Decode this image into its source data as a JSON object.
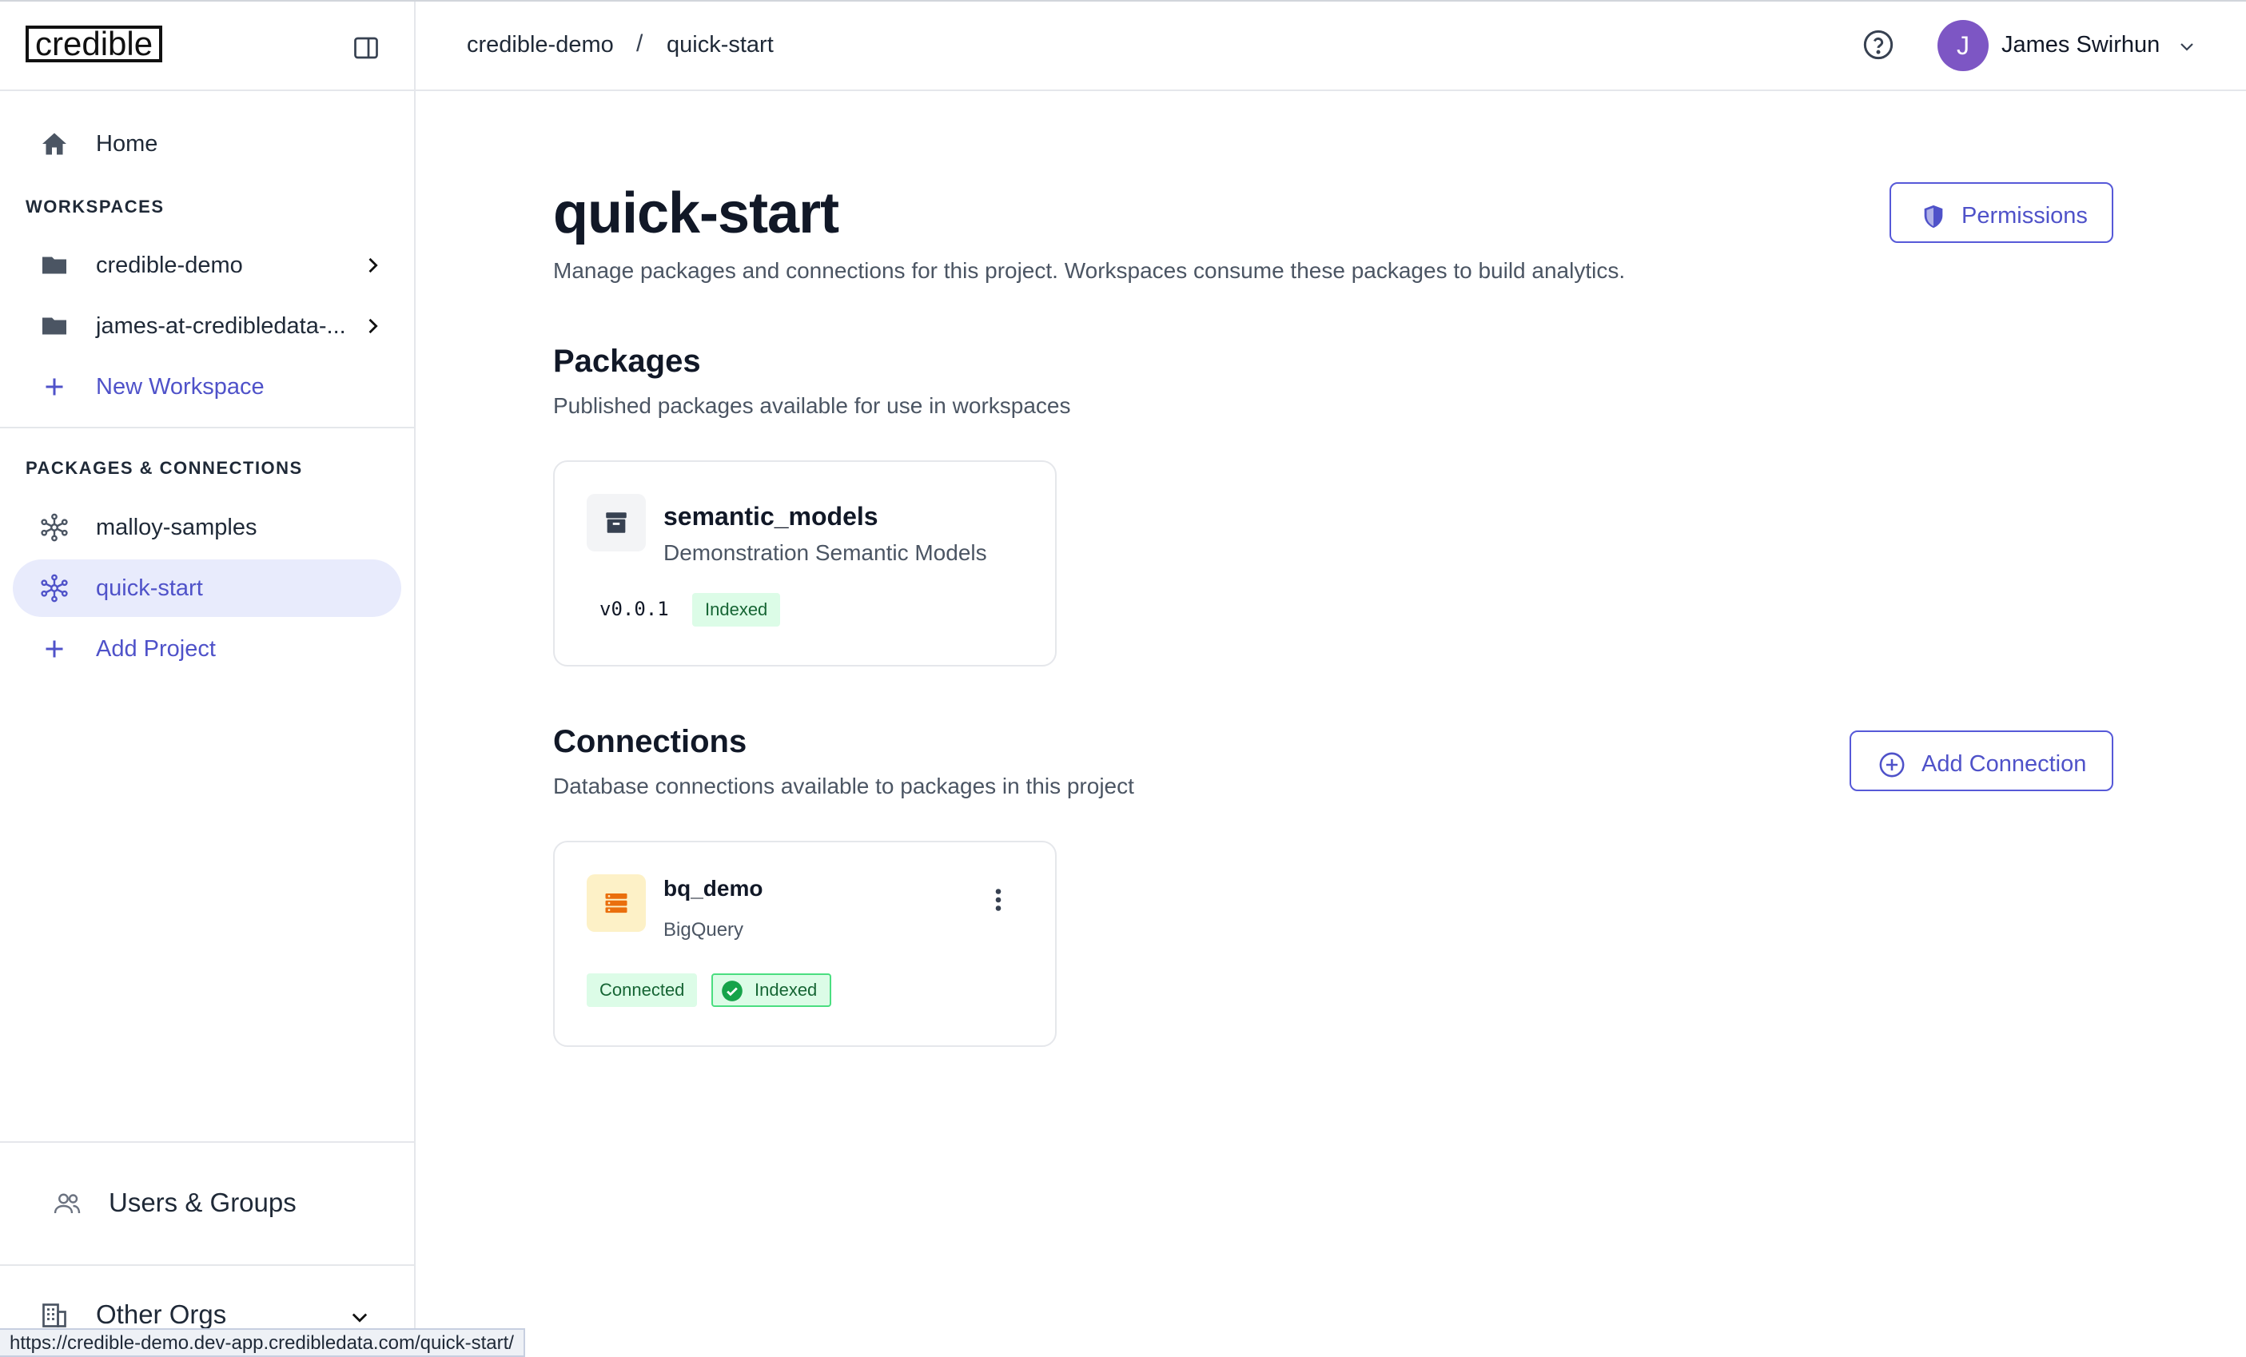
{
  "brand": {
    "logo_text": "credible"
  },
  "breadcrumb": {
    "org": "credible-demo",
    "separator": "/",
    "project": "quick-start"
  },
  "user": {
    "initial": "J",
    "name": "James Swirhun"
  },
  "sidebar": {
    "home_label": "Home",
    "workspaces_heading": "WORKSPACES",
    "workspaces": [
      {
        "label": "credible-demo"
      },
      {
        "label": "james-at-credibledata-..."
      }
    ],
    "new_workspace_label": "New Workspace",
    "packages_heading": "PACKAGES & CONNECTIONS",
    "projects": [
      {
        "label": "malloy-samples",
        "active": false
      },
      {
        "label": "quick-start",
        "active": true
      }
    ],
    "add_project_label": "Add Project",
    "users_groups_label": "Users & Groups",
    "other_orgs_label": "Other Orgs"
  },
  "page": {
    "title": "quick-start",
    "subtitle": "Manage packages and connections for this project. Workspaces consume these packages to build analytics.",
    "permissions_label": "Permissions"
  },
  "packages": {
    "title": "Packages",
    "subtitle": "Published packages available for use in workspaces",
    "items": [
      {
        "name": "semantic_models",
        "description": "Demonstration Semantic Models",
        "version": "v0.0.1",
        "status": "Indexed"
      }
    ]
  },
  "connections": {
    "title": "Connections",
    "subtitle": "Database connections available to packages in this project",
    "add_label": "Add Connection",
    "items": [
      {
        "name": "bq_demo",
        "type": "BigQuery",
        "status": "Connected",
        "index_status": "Indexed"
      }
    ]
  },
  "status_bar": {
    "url": "https://credible-demo.dev-app.credibledata.com/quick-start/"
  },
  "colors": {
    "accent": "#4f52c9",
    "active_bg": "#e8ebfc",
    "avatar": "#7d56c4",
    "success": "#16a34a"
  }
}
